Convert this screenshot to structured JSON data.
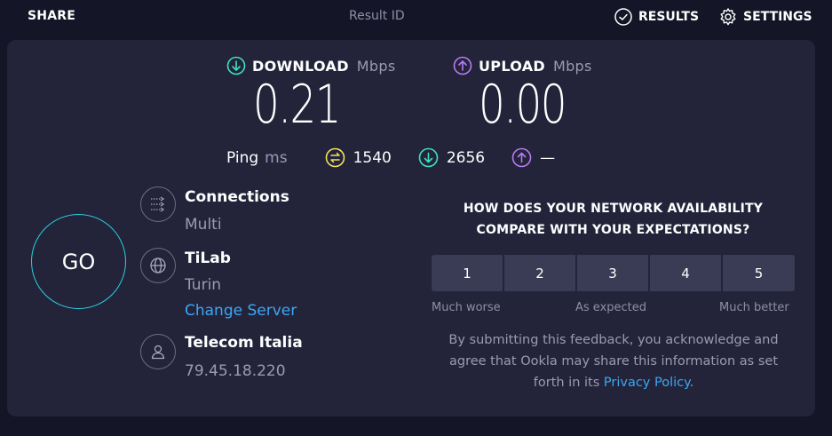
{
  "topbar": {
    "share_label": "SHARE",
    "result_id_label": "Result ID",
    "results_label": "RESULTS",
    "settings_label": "SETTINGS"
  },
  "download": {
    "label": "DOWNLOAD",
    "unit": "Mbps",
    "value": "0.21",
    "color": "#3ee0c4"
  },
  "upload": {
    "label": "UPLOAD",
    "unit": "Mbps",
    "value": "0.00",
    "color": "#b77bf2"
  },
  "ping": {
    "label": "Ping",
    "unit": "ms",
    "idle": "1540",
    "download": "2656",
    "upload": "—",
    "idle_color": "#f3e35a"
  },
  "go_label": "GO",
  "connections": {
    "title": "Connections",
    "value": "Multi"
  },
  "server": {
    "name": "TiLab",
    "location": "Turin",
    "change_label": "Change Server"
  },
  "provider": {
    "name": "Telecom Italia",
    "ip": "79.45.18.220"
  },
  "feedback": {
    "question_line1": "HOW DOES YOUR NETWORK AVAILABILITY",
    "question_line2": "COMPARE WITH YOUR EXPECTATIONS?",
    "options": [
      "1",
      "2",
      "3",
      "4",
      "5"
    ],
    "scale_low": "Much worse",
    "scale_mid": "As expected",
    "scale_high": "Much better",
    "disclaimer_line1": "By submitting this feedback, you acknowledge and",
    "disclaimer_line2": "agree that Ookla may share this information as set",
    "disclaimer_line3_prefix": "forth in its ",
    "privacy_link": "Privacy Policy",
    "disclaimer_suffix": "."
  },
  "icons": {
    "results": "check-circle-icon",
    "settings": "gear-icon",
    "download": "arrow-down-circle-icon",
    "upload": "arrow-up-circle-icon",
    "idle": "idle-latency-icon",
    "connections": "connections-icon",
    "server": "globe-icon",
    "provider": "person-icon"
  },
  "accent_color": "#2ad1e0",
  "link_color": "#3ba7f4"
}
